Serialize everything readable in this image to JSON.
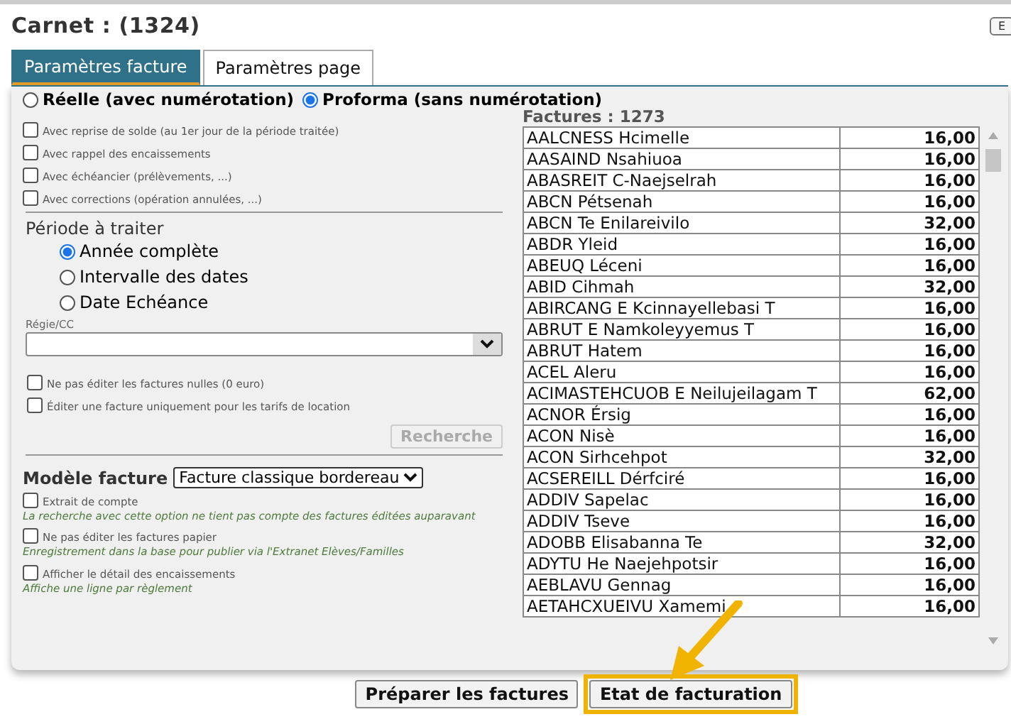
{
  "title": "Carnet : (1324)",
  "corner_buttons": [
    "E"
  ],
  "tabs": [
    {
      "label": "Paramètres facture",
      "selected": true
    },
    {
      "label": "Paramètres page",
      "selected": false
    }
  ],
  "invoice_types": [
    {
      "label": "Réelle (avec numérotation)",
      "selected": false
    },
    {
      "label": "Proforma (sans numérotation)",
      "selected": true
    }
  ],
  "options": [
    {
      "label": "Avec reprise de solde (au 1er jour de la période traitée)",
      "checked": false
    },
    {
      "label": "Avec rappel des encaissements",
      "checked": false
    },
    {
      "label": "Avec échéancier (prélèvements, ...)",
      "checked": false
    },
    {
      "label": "Avec corrections (opération annulées, ...)",
      "checked": false
    }
  ],
  "period": {
    "title": "Période à traiter",
    "choices": [
      {
        "label": "Année complète",
        "selected": true
      },
      {
        "label": "Intervalle des dates",
        "selected": false
      },
      {
        "label": "Date Echéance",
        "selected": false
      }
    ]
  },
  "regie": {
    "label": "Régie/CC"
  },
  "filters": [
    {
      "label": "Ne pas éditer les factures nulles (0 euro)",
      "checked": false
    },
    {
      "label": "Éditer une facture uniquement pour les tarifs de location",
      "checked": false
    }
  ],
  "search_button": {
    "label": "Recherche",
    "disabled": true
  },
  "model": {
    "label": "Modèle facture",
    "value": "Facture classique bordereau"
  },
  "model_options": [
    {
      "label": "Extrait de compte",
      "checked": false,
      "note": "La recherche avec cette option ne tient pas compte des factures éditées auparavant"
    },
    {
      "label": "Ne pas éditer les factures papier",
      "checked": false,
      "note": "Enregistrement dans la base pour publier via l'Extranet Elèves/Familles"
    },
    {
      "label": "Afficher le détail des encaissements",
      "checked": false,
      "note": "Affiche une ligne par règlement"
    }
  ],
  "invoices": {
    "title": "Factures : 1273",
    "rows": [
      {
        "name": "AALCNESS Hcimelle",
        "amount": "16,00"
      },
      {
        "name": "AASAIND Nsahiuoa",
        "amount": "16,00"
      },
      {
        "name": "ABASREIT C-Naejselrah",
        "amount": "16,00"
      },
      {
        "name": "ABCN Pétsenah",
        "amount": "16,00"
      },
      {
        "name": "ABCN Te Enilareivilo",
        "amount": "32,00"
      },
      {
        "name": "ABDR Yleid",
        "amount": "16,00"
      },
      {
        "name": "ABEUQ Léceni",
        "amount": "16,00"
      },
      {
        "name": "ABID Cihmah",
        "amount": "32,00"
      },
      {
        "name": "ABIRCANG E Kcinnayellebasi T",
        "amount": "16,00"
      },
      {
        "name": "ABRUT E Namkoleyyemus T",
        "amount": "16,00"
      },
      {
        "name": "ABRUT Hatem",
        "amount": "16,00"
      },
      {
        "name": "ACEL Aleru",
        "amount": "16,00"
      },
      {
        "name": "ACIMASTEHCUOB E Neilujeilagam T",
        "amount": "62,00"
      },
      {
        "name": "ACNOR Érsig",
        "amount": "16,00"
      },
      {
        "name": "ACON Nisè",
        "amount": "16,00"
      },
      {
        "name": "ACON Sirhcehpot",
        "amount": "32,00"
      },
      {
        "name": "ACSEREILL Dérfciré",
        "amount": "16,00"
      },
      {
        "name": "ADDIV Sapelac",
        "amount": "16,00"
      },
      {
        "name": "ADDIV Tseve",
        "amount": "16,00"
      },
      {
        "name": "ADOBB Elisabanna Te",
        "amount": "32,00"
      },
      {
        "name": "ADYTU He Naejehpotsir",
        "amount": "16,00"
      },
      {
        "name": "AEBLAVU Gennag",
        "amount": "16,00"
      },
      {
        "name": "AETAHCXUEIVU Xamemi",
        "amount": "16,00"
      }
    ]
  },
  "actions": [
    {
      "label": "Préparer les factures",
      "highlighted": false
    },
    {
      "label": "Etat de facturation",
      "highlighted": true
    }
  ]
}
